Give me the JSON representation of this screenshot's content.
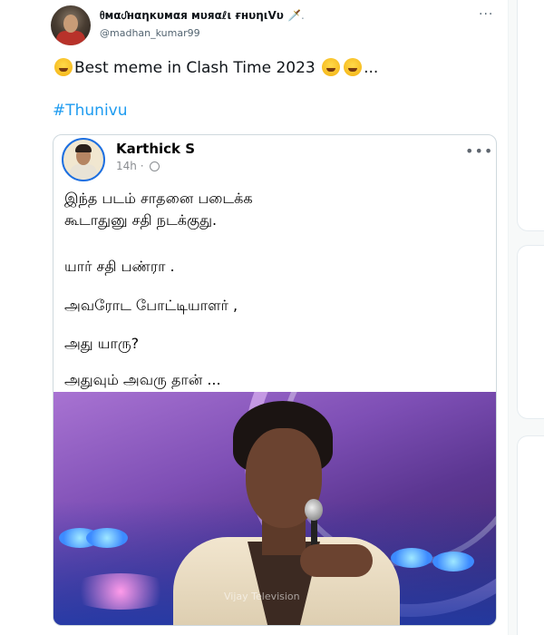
{
  "tweet": {
    "display_name": "ᦲмαᦔнαηкυмαя мυяαℓι ғнυηιᐯυ",
    "display_name_suffix": "🗡️.",
    "handle": "@madhan_kumar99",
    "more_label": "···",
    "text": "Best meme in Clash Time 2023",
    "text_suffix": "...",
    "hashtag": "#Thunivu",
    "emojis": [
      "smiling-face-with-hand-over-mouth",
      "grinning-face-with-sweat",
      "face-with-tears-of-joy"
    ]
  },
  "quoted_post": {
    "author": "Karthick S",
    "time": "14h",
    "meta_separator": "·",
    "more_label": "•••",
    "lines": [
      "இந்த படம் சாதனை படைக்க",
      "கூடாதுனு சதி நடக்குது.",
      "யார் சதி பண்ரா .",
      "அவரோட போட்டியாளர் ,",
      "அது யாரு?",
      "அதுவும் அவரு தான் ..."
    ],
    "image_watermark": "Vijay Television"
  },
  "colors": {
    "link": "#1d9bf0",
    "text": "#0f1419",
    "secondary": "#536471",
    "border": "#cfd9de"
  }
}
